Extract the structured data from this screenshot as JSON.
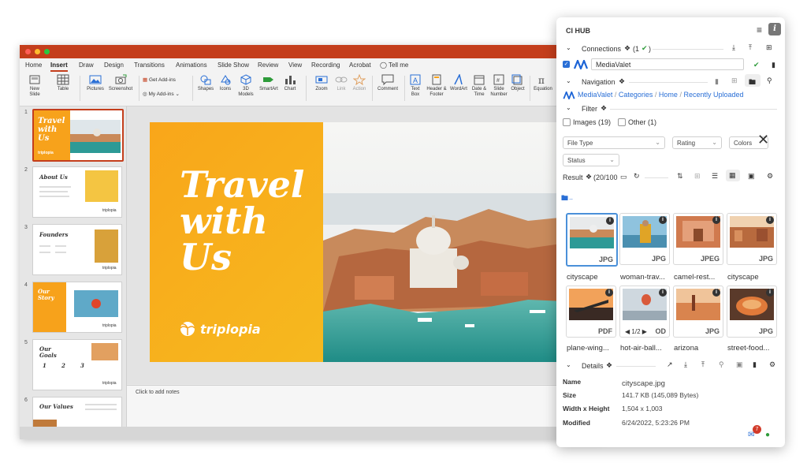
{
  "ppt": {
    "tabs": [
      "Home",
      "Insert",
      "Draw",
      "Design",
      "Transitions",
      "Animations",
      "Slide Show",
      "Review",
      "View",
      "Recording",
      "Acrobat",
      "Tell me"
    ],
    "active_tab": "Insert",
    "ribbon": {
      "new_slide": "New Slide",
      "table": "Table",
      "pictures": "Pictures",
      "screenshot": "Screenshot",
      "get_addins": "Get Add-ins",
      "my_addins": "My Add-ins",
      "shapes": "Shapes",
      "icons": "Icons",
      "models3d": "3D Models",
      "smartart": "SmartArt",
      "chart": "Chart",
      "zoom": "Zoom",
      "link": "Link",
      "action": "Action",
      "comment": "Comment",
      "textbox": "Text Box",
      "header_footer": "Header & Footer",
      "wordart": "WordArt",
      "date_time": "Date & Time",
      "slide_number": "Slide Number",
      "object": "Object",
      "equation": "Equation"
    },
    "slides": [
      {
        "num": "1",
        "title": "Travel with Us"
      },
      {
        "num": "2",
        "title": "About Us"
      },
      {
        "num": "3",
        "title": "Founders"
      },
      {
        "num": "4",
        "title": "Our Story"
      },
      {
        "num": "5",
        "title": "Our Goals",
        "nums": [
          "1",
          "2",
          "3"
        ]
      },
      {
        "num": "6",
        "title": "Our Values"
      }
    ],
    "thumb_brand": "triplopia",
    "main_slide": {
      "title_lines": [
        "Travel",
        "with",
        "Us"
      ],
      "brand": "triplopia"
    },
    "notes_placeholder": "Click to add notes",
    "colors": {
      "accent": "#c43e1c",
      "orange": "#f7a21b"
    }
  },
  "cihub": {
    "title": "CI HUB",
    "connections_label": "Connections",
    "connections_count": "(1",
    "connection_name": "MediaValet",
    "navigation_label": "Navigation",
    "breadcrumb": [
      "MediaValet",
      "Categories",
      "Home",
      "Recently Uploaded"
    ],
    "filter_label": "Filter",
    "images_filter": "Images (19)",
    "other_filter": "Other (1)",
    "file_type": "File Type",
    "rating": "Rating",
    "colors_label": "Colors",
    "status_label": "Status",
    "result_label": "Result",
    "result_count": "(20/100",
    "folder_up": "..",
    "assets": [
      {
        "name": "cityscape",
        "ext": "JPG"
      },
      {
        "name": "woman-trav...",
        "ext": "JPG"
      },
      {
        "name": "camel-rest...",
        "ext": "JPEG"
      },
      {
        "name": "cityscape",
        "ext": "JPG"
      },
      {
        "name": "plane-wing...",
        "ext": "PDF"
      },
      {
        "name": "hot-air-ball...",
        "ext": "OD",
        "pager": "1/2"
      },
      {
        "name": "arizona",
        "ext": "JPG"
      },
      {
        "name": "street-food...",
        "ext": "JPG"
      }
    ],
    "details_label": "Details",
    "details": {
      "name_label": "Name",
      "name": "cityscape.jpg",
      "size_label": "Size",
      "size": "141.7 KB (145,089 Bytes)",
      "wh_label": "Width x Height",
      "wh": "1,504 x 1,003",
      "modified_label": "Modified",
      "modified": "6/24/2022, 5:23:26 PM"
    },
    "badge_count": "7",
    "colors": {
      "link": "#2a6fd6",
      "check": "#2e9b3a"
    }
  }
}
